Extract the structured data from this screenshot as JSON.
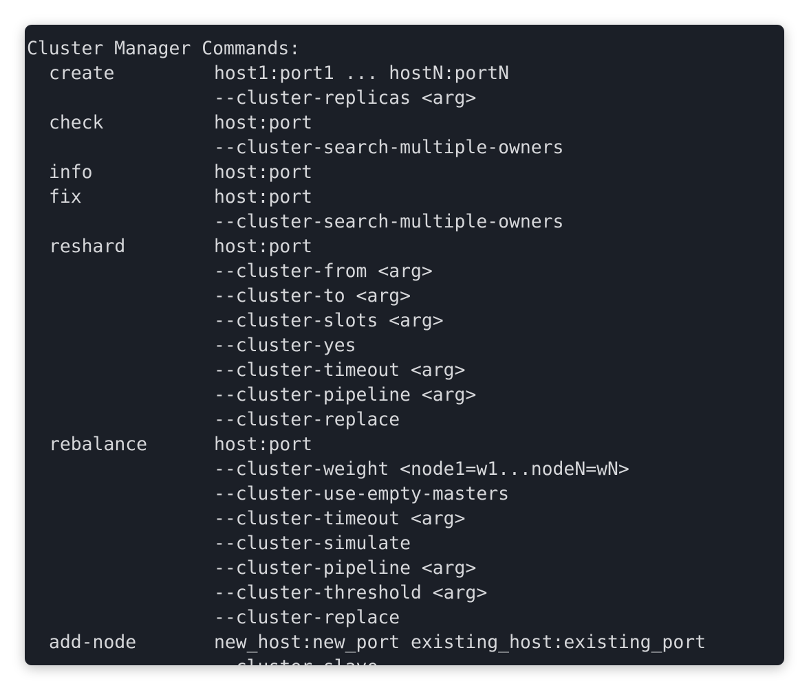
{
  "terminal": {
    "heading": "Cluster Manager Commands:",
    "lines": [
      {
        "cmd": "create",
        "arg": "host1:port1 ... hostN:portN"
      },
      {
        "cmd": "",
        "arg": "--cluster-replicas <arg>"
      },
      {
        "cmd": "check",
        "arg": "host:port"
      },
      {
        "cmd": "",
        "arg": "--cluster-search-multiple-owners"
      },
      {
        "cmd": "info",
        "arg": "host:port"
      },
      {
        "cmd": "fix",
        "arg": "host:port"
      },
      {
        "cmd": "",
        "arg": "--cluster-search-multiple-owners"
      },
      {
        "cmd": "reshard",
        "arg": "host:port"
      },
      {
        "cmd": "",
        "arg": "--cluster-from <arg>"
      },
      {
        "cmd": "",
        "arg": "--cluster-to <arg>"
      },
      {
        "cmd": "",
        "arg": "--cluster-slots <arg>"
      },
      {
        "cmd": "",
        "arg": "--cluster-yes"
      },
      {
        "cmd": "",
        "arg": "--cluster-timeout <arg>"
      },
      {
        "cmd": "",
        "arg": "--cluster-pipeline <arg>"
      },
      {
        "cmd": "",
        "arg": "--cluster-replace"
      },
      {
        "cmd": "rebalance",
        "arg": "host:port"
      },
      {
        "cmd": "",
        "arg": "--cluster-weight <node1=w1...nodeN=wN>"
      },
      {
        "cmd": "",
        "arg": "--cluster-use-empty-masters"
      },
      {
        "cmd": "",
        "arg": "--cluster-timeout <arg>"
      },
      {
        "cmd": "",
        "arg": "--cluster-simulate"
      },
      {
        "cmd": "",
        "arg": "--cluster-pipeline <arg>"
      },
      {
        "cmd": "",
        "arg": "--cluster-threshold <arg>"
      },
      {
        "cmd": "",
        "arg": "--cluster-replace"
      },
      {
        "cmd": "add-node",
        "arg": "new_host:new_port existing_host:existing_port"
      },
      {
        "cmd": "",
        "arg": "--cluster-slave"
      }
    ]
  },
  "colors": {
    "background": "#1b1f27",
    "text": "#d6d7da",
    "page": "#ffffff"
  }
}
